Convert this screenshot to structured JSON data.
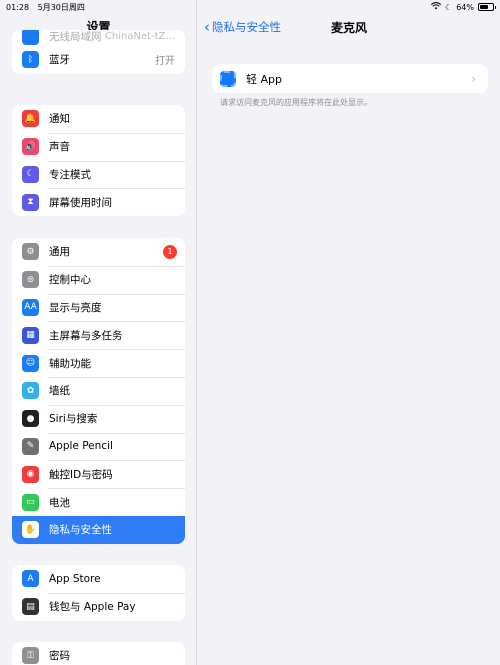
{
  "status": {
    "time": "01:28",
    "date": "5月30日周四",
    "battery": "64%",
    "battery_level": 0.64
  },
  "sidebar": {
    "title": "设置",
    "partial_row": "无线局域网",
    "partial_row_detail": "ChinaNet-tZ...",
    "group1": [
      {
        "label": "蓝牙",
        "detail": "打开",
        "icon": "bluetooth-icon",
        "color": "#1a7cf2"
      }
    ],
    "group2": [
      {
        "label": "通知",
        "icon": "bell-icon",
        "color": "#f23b3b"
      },
      {
        "label": "声音",
        "icon": "speaker-icon",
        "color": "#f2456a"
      },
      {
        "label": "专注模式",
        "icon": "moon-icon",
        "color": "#5e5ce6"
      },
      {
        "label": "屏幕使用时间",
        "icon": "hourglass-icon",
        "color": "#5e5ce6"
      }
    ],
    "group3": [
      {
        "label": "通用",
        "icon": "gear-icon",
        "color": "#8e8e93",
        "badge": "1"
      },
      {
        "label": "控制中心",
        "icon": "toggles-icon",
        "color": "#8e8e93"
      },
      {
        "label": "显示与亮度",
        "icon": "text-size-icon",
        "color": "#1a7cf2"
      },
      {
        "label": "主屏幕与多任务",
        "icon": "grid-icon",
        "color": "#3a56d9"
      },
      {
        "label": "辅助功能",
        "icon": "accessibility-icon",
        "color": "#1a7cf2"
      },
      {
        "label": "墙纸",
        "icon": "flower-icon",
        "color": "#33b0e8"
      },
      {
        "label": "Siri与搜索",
        "icon": "siri-icon",
        "color": "#222222"
      },
      {
        "label": "Apple Pencil",
        "icon": "pencil-icon",
        "color": "#6e6e73"
      },
      {
        "label": "触控ID与密码",
        "icon": "fingerprint-icon",
        "color": "#f23b3b"
      },
      {
        "label": "电池",
        "icon": "battery-icon",
        "color": "#34c759"
      },
      {
        "label": "隐私与安全性",
        "icon": "hand-icon",
        "color": "#1a7cf2",
        "selected": true
      }
    ],
    "group4": [
      {
        "label": "App Store",
        "icon": "app-store-icon",
        "color": "#1a7cf2"
      },
      {
        "label": "钱包与 Apple Pay",
        "icon": "wallet-icon",
        "color": "#333333"
      }
    ],
    "group5": [
      {
        "label": "密码",
        "icon": "key-icon",
        "color": "#8e8e93"
      }
    ]
  },
  "main": {
    "back_label": "隐私与安全性",
    "title": "麦克风",
    "app_row": {
      "label": "轻 App",
      "icon": "light-app-icon"
    },
    "note": "请求访问麦克风的应用程序将在此处显示。"
  }
}
